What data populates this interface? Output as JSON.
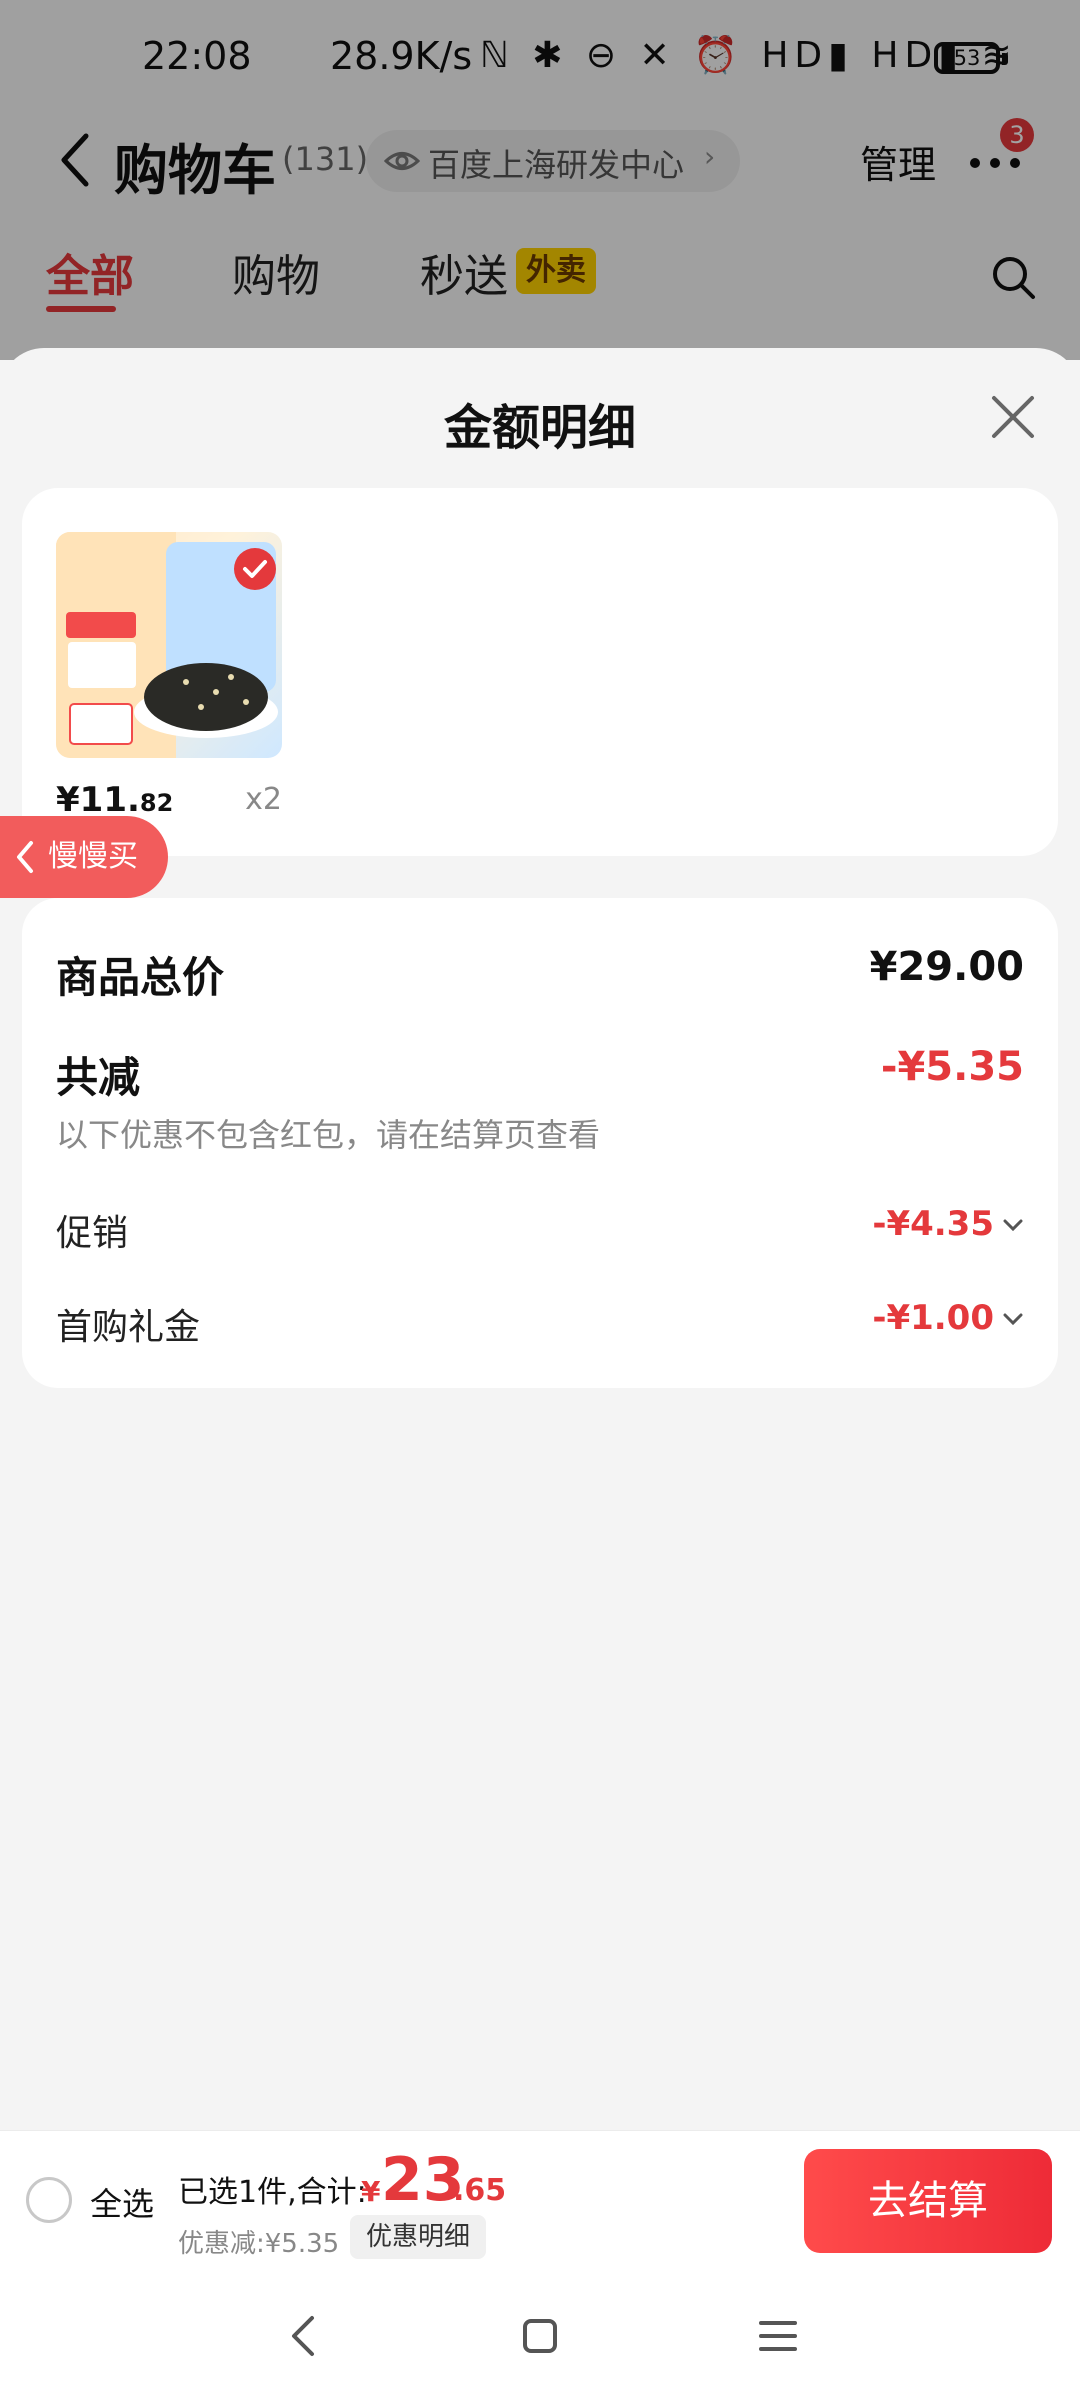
{
  "status_bar": {
    "time": "22:08",
    "net_speed": "28.9K/s",
    "icons_text": "ℕ ✱ ⊖ ✕ ⏰ HD▮ HD▮ ≋",
    "battery": "53"
  },
  "nav": {
    "title": "购物车",
    "count": "(131)",
    "location": "百度上海研发中心",
    "manage": "管理",
    "more_badge": "3"
  },
  "tabs": {
    "all": "全部",
    "shopping": "购物",
    "flash": "秒送",
    "takeout": "外卖"
  },
  "sheet": {
    "title": "金额明细"
  },
  "product": {
    "price_int": "¥11.",
    "price_dec": "82",
    "qty": "x2"
  },
  "slow_buy": {
    "label": "慢慢买"
  },
  "details": {
    "total_label": "商品总价",
    "total_value": "¥29.00",
    "reduce_label": "共减",
    "reduce_value": "-¥5.35",
    "note": "以下优惠不包含红包，请在结算页查看",
    "promo_label": "促销",
    "promo_value": "-¥4.35",
    "gift_label": "首购礼金",
    "gift_value": "-¥1.00"
  },
  "bottom": {
    "select_all": "全选",
    "selected_text": "已选1件,合计:",
    "currency": "¥",
    "amount_int": "23",
    "amount_dec": ".65",
    "discount_text": "优惠减:¥5.35",
    "discount_detail_btn": "优惠明细",
    "checkout": "去结算"
  },
  "colors": {
    "accent": "#e4393c",
    "checkout_gradient_start": "#ff4b4b",
    "checkout_gradient_end": "#ee2b37",
    "takeout_yellow": "#ffd200"
  }
}
